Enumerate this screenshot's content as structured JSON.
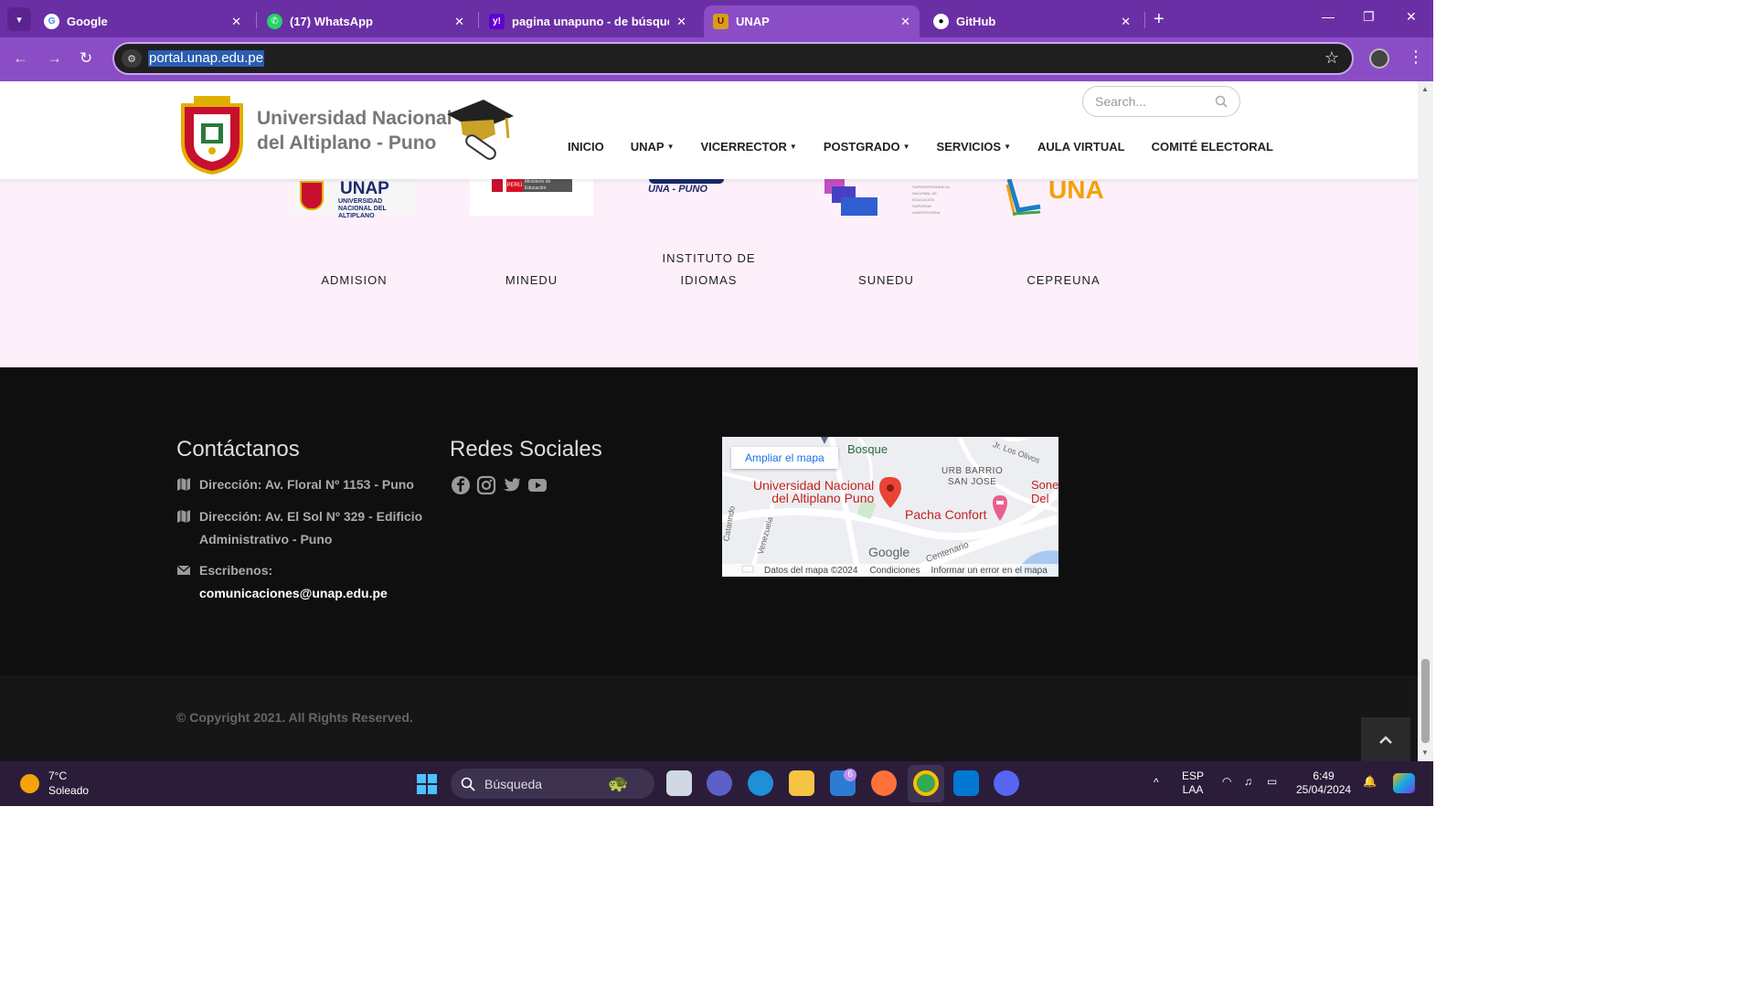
{
  "browser": {
    "tabs": [
      {
        "title": "Google",
        "active": false
      },
      {
        "title": "(17) WhatsApp",
        "active": false
      },
      {
        "title": "pagina unapuno - de búsqueda",
        "active": false
      },
      {
        "title": "UNAP",
        "active": true
      },
      {
        "title": "GitHub",
        "active": false
      }
    ],
    "url": "portal.unap.edu.pe"
  },
  "site": {
    "logo_line1": "Universidad Nacional",
    "logo_line2": "del Altiplano - Puno",
    "search_placeholder": "Search...",
    "nav": [
      {
        "label": "INICIO",
        "dropdown": false
      },
      {
        "label": "UNAP",
        "dropdown": true
      },
      {
        "label": "VICERRECTOR",
        "dropdown": true
      },
      {
        "label": "POSTGRADO",
        "dropdown": true
      },
      {
        "label": "SERVICIOS",
        "dropdown": true
      },
      {
        "label": "AULA VIRTUAL",
        "dropdown": false
      },
      {
        "label": "COMITÉ ELECTORAL",
        "dropdown": false
      }
    ]
  },
  "partners": [
    {
      "label": "ADMISION",
      "logo_text": "UNAP",
      "logo_sub": "UNIVERSIDAD NACIONAL DEL ALTIPLANO"
    },
    {
      "label": "MINEDU",
      "logo_text": "PERÚ",
      "logo_sub": "Ministerio de Educación"
    },
    {
      "label_line1": "INSTITUTO DE",
      "label_line2": "IDIOMAS",
      "logo_text": "UNA - PUNO"
    },
    {
      "label": "SUNEDU",
      "logo_sub": "SUPERINTENDENCIA NACIONAL DE EDUCACIÓN SUPERIOR UNIVERSITARIA"
    },
    {
      "label": "CEPREUNA",
      "logo_text": "UNA"
    }
  ],
  "footer": {
    "contact_heading": "Contáctanos",
    "address1": "Dirección: Av. Floral Nº 1153 - Puno",
    "address2_line1": "Dirección: Av. El Sol Nº 329 - Edificio",
    "address2_line2": "Administrativo - Puno",
    "write_label": "Escribenos:",
    "email": "comunicaciones@unap.edu.pe",
    "social_heading": "Redes Sociales",
    "social_icons": [
      "facebook-icon",
      "instagram-icon",
      "twitter-icon",
      "youtube-icon"
    ],
    "map": {
      "enlarge_link": "Ampliar el mapa",
      "place_label_line1": "Universidad Nacional",
      "place_label_line2": "del Altiplano Puno",
      "label_bosque": "Bosque",
      "label_urb_line1": "URB BARRIO",
      "label_urb_line2": "SAN JOSE",
      "label_pacha": "Pacha Confort",
      "label_olivos": "Jr. Los Olivos",
      "label_sones_line1": "Sonest",
      "label_sones_line2": "Del",
      "label_catarindo": "Catarindo",
      "label_venezuela": "Venezuela",
      "label_centenario": "Centenario",
      "google": "Google",
      "attribution": "Datos del mapa ©2024",
      "terms": "Condiciones",
      "report": "Informar un error en el mapa"
    },
    "copyright": "© Copyright 2021. All Rights Reserved."
  },
  "taskbar": {
    "temperature": "7°C",
    "weather": "Soleado",
    "search_label": "Búsqueda",
    "mail_badge": "6",
    "lang1": "ESP",
    "lang2": "LAA",
    "time": "6:49",
    "date": "25/04/2024"
  },
  "colors": {
    "tab_bar": "#6b2fa5",
    "toolbar": "#8a4dc6",
    "partners_bg": "#fdf0fb",
    "footer_bg": "#0f0f0f",
    "map_pin": "#ea4335"
  }
}
